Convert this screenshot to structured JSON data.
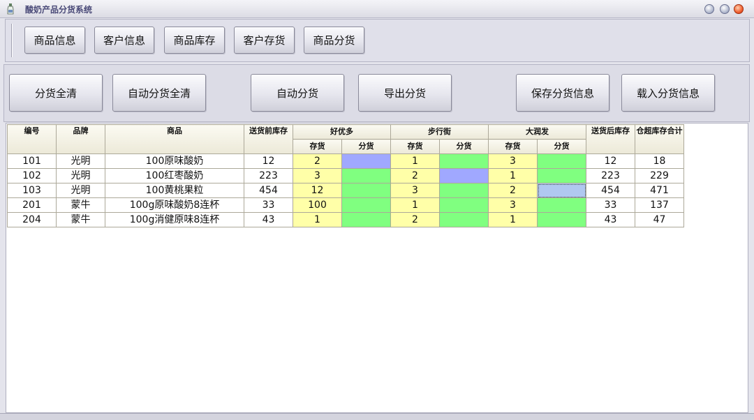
{
  "window": {
    "title": "酸奶产品分货系统",
    "icon": "bottle-icon"
  },
  "nav": {
    "buttons": [
      "商品信息",
      "客户信息",
      "商品库存",
      "客户存货",
      "商品分货"
    ]
  },
  "actions": {
    "clear_all": "分货全清",
    "auto_clear_all": "自动分货全清",
    "auto_allocate": "自动分货",
    "export": "导出分货",
    "save": "保存分货信息",
    "load": "载入分货信息"
  },
  "table": {
    "headers": {
      "id": "编号",
      "brand": "品牌",
      "product": "商品",
      "stock_before": "送货前库存",
      "stores": [
        "好优多",
        "步行街",
        "大润发"
      ],
      "stock": "存货",
      "allocate": "分货",
      "stock_after": "送货后库存",
      "overflow_total": "仓超库存合计"
    },
    "rows": [
      {
        "id": "101",
        "brand": "光明",
        "product": "100原味酸奶",
        "before": "12",
        "s1": "2",
        "a1": "",
        "s2": "1",
        "a2": "",
        "s3": "3",
        "a3": "",
        "after": "12",
        "total": "18"
      },
      {
        "id": "102",
        "brand": "光明",
        "product": "100红枣酸奶",
        "before": "223",
        "s1": "3",
        "a1": "",
        "s2": "2",
        "a2": "",
        "s3": "1",
        "a3": "",
        "after": "223",
        "total": "229"
      },
      {
        "id": "103",
        "brand": "光明",
        "product": "100黄桃果粒",
        "before": "454",
        "s1": "12",
        "a1": "",
        "s2": "3",
        "a2": "",
        "s3": "2",
        "a3": "",
        "after": "454",
        "total": "471"
      },
      {
        "id": "201",
        "brand": "蒙牛",
        "product": "100g原味酸奶8连杯",
        "before": "33",
        "s1": "100",
        "a1": "",
        "s2": "1",
        "a2": "",
        "s3": "3",
        "a3": "",
        "after": "33",
        "total": "137"
      },
      {
        "id": "204",
        "brand": "蒙牛",
        "product": "100g消健原味8连杯",
        "before": "43",
        "s1": "1",
        "a1": "",
        "s2": "2",
        "a2": "",
        "s3": "1",
        "a3": "",
        "after": "43",
        "total": "47"
      }
    ]
  },
  "colors": {
    "stock_cell": "#ffffa8",
    "allocate_cell": "#80ff80",
    "allocate_highlight": "#a0a8ff",
    "selected_cell": "#b0c8f0"
  }
}
